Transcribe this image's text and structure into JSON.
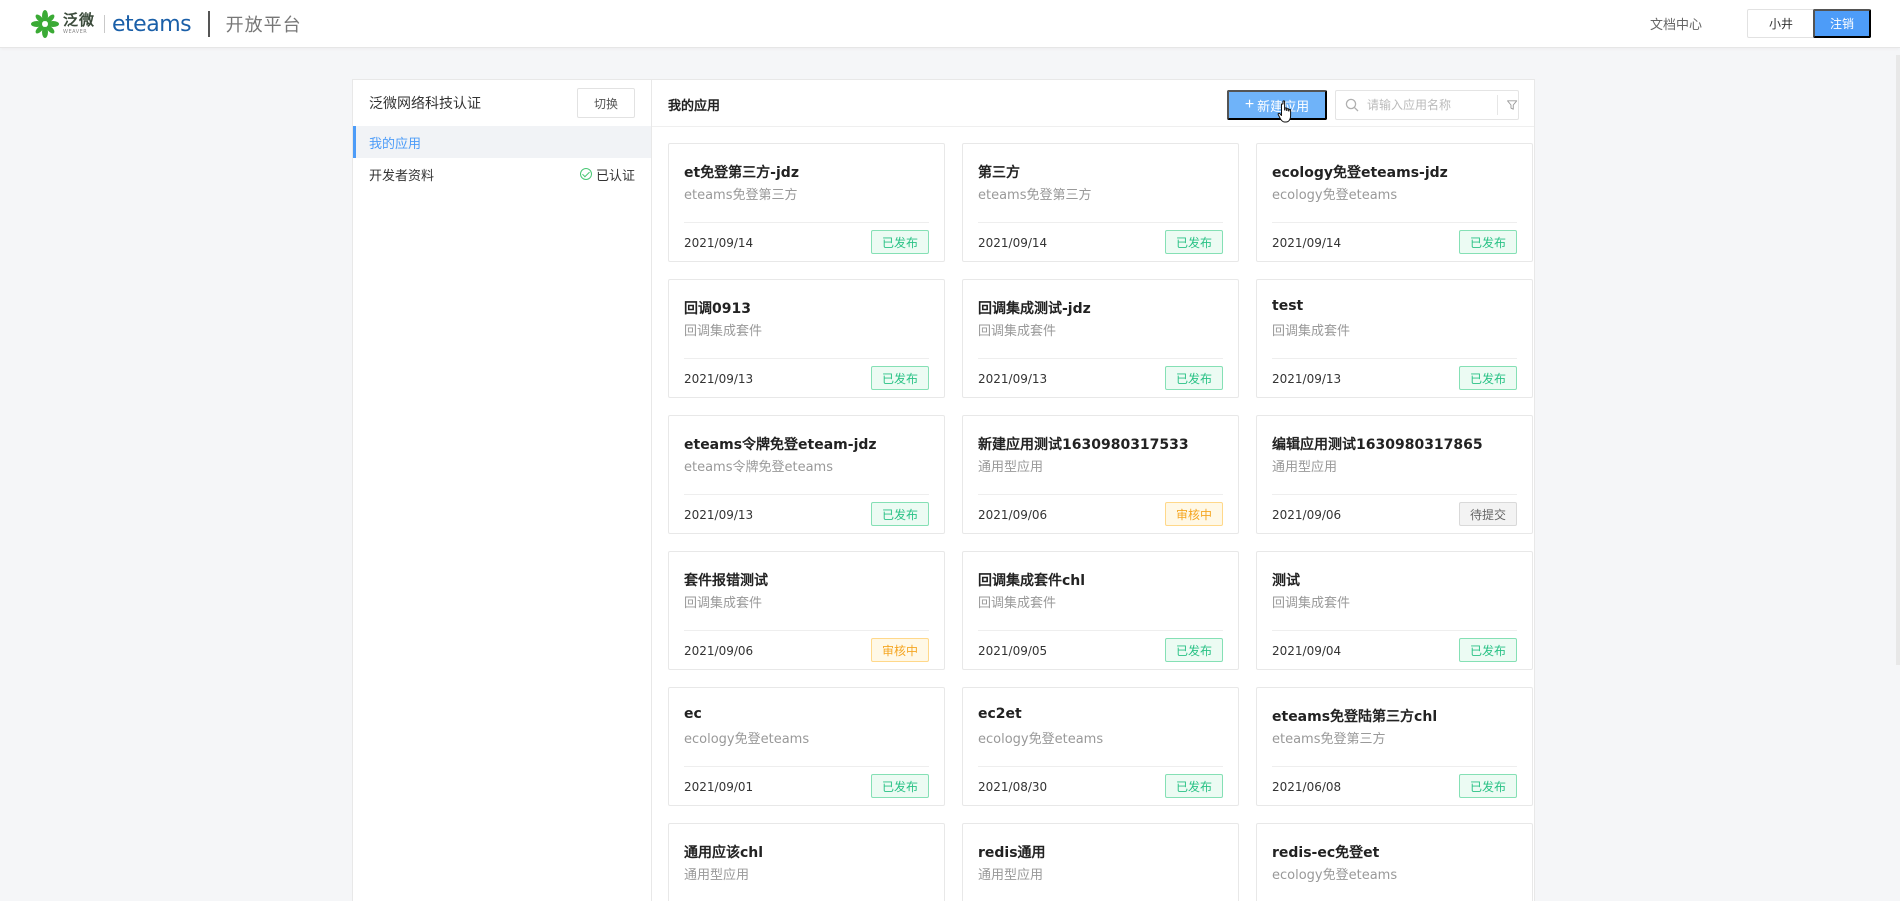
{
  "header": {
    "brand_cn": "泛微",
    "brand_en": "WEAVER",
    "product": "eteams",
    "platform": "开放平台",
    "doc_center": "文档中心",
    "user": "小井",
    "logout": "注销",
    "accent_color": "#4d9cf8"
  },
  "sidebar": {
    "org_name": "泛微网络科技认证",
    "switch_label": "切换",
    "items": [
      {
        "label": "我的应用",
        "active": true
      },
      {
        "label": "开发者资料",
        "status": "已认证"
      }
    ]
  },
  "main": {
    "title": "我的应用",
    "new_app_label": "新建应用",
    "search_placeholder": "请输入应用名称",
    "cards": [
      {
        "name": "et免登第三方-jdz",
        "type": "eteams免登第三方",
        "date": "2021/09/14",
        "status": "已发布",
        "status_kind": "published"
      },
      {
        "name": "第三方",
        "type": "eteams免登第三方",
        "date": "2021/09/14",
        "status": "已发布",
        "status_kind": "published"
      },
      {
        "name": "ecology免登eteams-jdz",
        "type": "ecology免登eteams",
        "date": "2021/09/14",
        "status": "已发布",
        "status_kind": "published"
      },
      {
        "name": "回调0913",
        "type": "回调集成套件",
        "date": "2021/09/13",
        "status": "已发布",
        "status_kind": "published"
      },
      {
        "name": "回调集成测试-jdz",
        "type": "回调集成套件",
        "date": "2021/09/13",
        "status": "已发布",
        "status_kind": "published"
      },
      {
        "name": "test",
        "type": "回调集成套件",
        "date": "2021/09/13",
        "status": "已发布",
        "status_kind": "published"
      },
      {
        "name": "eteams令牌免登eteam-jdz",
        "type": "eteams令牌免登eteams",
        "date": "2021/09/13",
        "status": "已发布",
        "status_kind": "published"
      },
      {
        "name": "新建应用测试1630980317533",
        "type": "通用型应用",
        "date": "2021/09/06",
        "status": "审核中",
        "status_kind": "reviewing"
      },
      {
        "name": "编辑应用测试1630980317865",
        "type": "通用型应用",
        "date": "2021/09/06",
        "status": "待提交",
        "status_kind": "pending"
      },
      {
        "name": "套件报错测试",
        "type": "回调集成套件",
        "date": "2021/09/06",
        "status": "审核中",
        "status_kind": "reviewing"
      },
      {
        "name": "回调集成套件chl",
        "type": "回调集成套件",
        "date": "2021/09/05",
        "status": "已发布",
        "status_kind": "published"
      },
      {
        "name": "测试",
        "type": "回调集成套件",
        "date": "2021/09/04",
        "status": "已发布",
        "status_kind": "published"
      },
      {
        "name": "ec",
        "type": "ecology免登eteams",
        "date": "2021/09/01",
        "status": "已发布",
        "status_kind": "published"
      },
      {
        "name": "ec2et",
        "type": "ecology免登eteams",
        "date": "2021/08/30",
        "status": "已发布",
        "status_kind": "published"
      },
      {
        "name": "eteams免登陆第三方chl",
        "type": "eteams免登第三方",
        "date": "2021/06/08",
        "status": "已发布",
        "status_kind": "published"
      },
      {
        "name": "通用应该chl",
        "type": "通用型应用",
        "date": "",
        "status": "",
        "status_kind": "published"
      },
      {
        "name": "redis通用",
        "type": "通用型应用",
        "date": "",
        "status": "",
        "status_kind": "published"
      },
      {
        "name": "redis-ec免登et",
        "type": "ecology免登eteams",
        "date": "",
        "status": "",
        "status_kind": "published"
      }
    ]
  }
}
